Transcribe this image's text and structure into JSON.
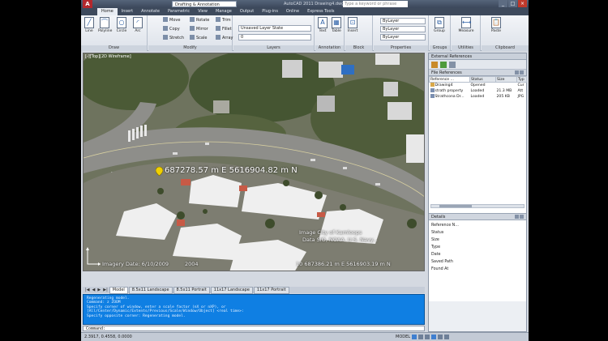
{
  "titlebar": {
    "app_button": "A",
    "workspace": "Drafting & Annotation",
    "window_title": "AutoCAD 2011   Drawing4.dwg",
    "search_placeholder": "Type a keyword or phrase",
    "controls": [
      "_",
      "□",
      "×"
    ]
  },
  "ribbon_tabs": [
    "Home",
    "Insert",
    "Annotate",
    "Parametric",
    "View",
    "Manage",
    "Output",
    "Plug-ins",
    "Online",
    "Express Tools"
  ],
  "panels": {
    "draw": {
      "label": "Draw",
      "tools": [
        "Line",
        "Polyline",
        "Circle",
        "Arc"
      ]
    },
    "modify": {
      "label": "Modify",
      "tools": [
        "Move",
        "Rotate",
        "Trim",
        "Copy",
        "Mirror",
        "Fillet",
        "Stretch",
        "Scale",
        "Array"
      ]
    },
    "layers": {
      "label": "Layers",
      "layer_state": "Unsaved Layer State",
      "current_layer": "0"
    },
    "annotation": {
      "label": "Annotation",
      "tools": [
        "Text",
        "Table"
      ]
    },
    "block": {
      "label": "Block",
      "tools": [
        "Insert"
      ]
    },
    "properties": {
      "label": "Properties",
      "values": [
        "ByLayer",
        "ByLayer",
        "ByLayer"
      ]
    },
    "groups": {
      "label": "Groups",
      "tools": [
        "Group"
      ]
    },
    "utilities": {
      "label": "Utilities",
      "tools": [
        "Measure"
      ]
    },
    "clipboard": {
      "label": "Clipboard",
      "tools": [
        "Paste"
      ]
    }
  },
  "viewport": {
    "label": "[-][Top][2D Wireframe]",
    "coord_readout": "687278.57 m E  5616904.82 m N",
    "attribution_1": "Image City of Kamloops",
    "attribution_2": "Data SIO, NOAA, U.S. Navy...",
    "imagery_date": "Imagery Date: 6/10/2009",
    "imagery_year": "2004",
    "bottom_coord": "10 687386.21 m E  5616903.19 m N"
  },
  "layout_tabs": {
    "nav": [
      "|◀",
      "◀",
      "▶",
      "▶|"
    ],
    "tabs": [
      "Model",
      "8.5x11 Landscape",
      "8.5x11 Portrait",
      "11x17 Landscape",
      "11x17 Portrait"
    ]
  },
  "command": {
    "lines": [
      "Regenerating model.",
      "Command: z ZOOM",
      "Specify corner of window, enter a scale factor (nX or nXP), or",
      "[All/Center/Dynamic/Extents/Previous/Scale/Window/Object] <real time>:",
      "Specify opposite corner: Regenerating model."
    ],
    "prompt": "Command:"
  },
  "statusbar": {
    "coords": "2.3917, 0.4558, 0.0000",
    "model": "MODEL"
  },
  "xref_palette": {
    "title": "External References",
    "file_refs_header": "File References",
    "columns": [
      "Reference ...",
      "Status",
      "Size",
      "Typ"
    ],
    "rows": [
      {
        "name": "Drawing4",
        "status": "Opened",
        "size": "",
        "type": "Cur"
      },
      {
        "name": "strath property",
        "status": "Loaded",
        "size": "21.3 MB",
        "type": "Att"
      },
      {
        "name": "Strathcona Dr...",
        "status": "Loaded",
        "size": "205 KB",
        "type": "JPG"
      }
    ],
    "details_header": "Details",
    "details_fields": [
      "Reference N...",
      "Status",
      "Size",
      "Type",
      "Date",
      "Saved Path",
      "Found At"
    ]
  }
}
